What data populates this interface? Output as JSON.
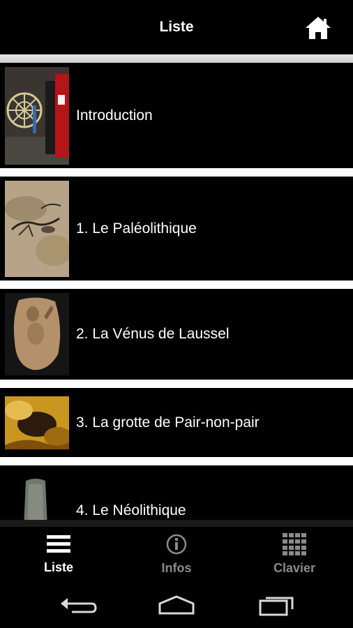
{
  "header": {
    "title": "Liste",
    "home_icon": "home-icon"
  },
  "list": {
    "items": [
      {
        "label": "Introduction",
        "thumb": "intro-image"
      },
      {
        "label": "1. Le Paléolithique",
        "thumb": "cave-painting-image"
      },
      {
        "label": "2. La Vénus de Laussel",
        "thumb": "venus-relief-image"
      },
      {
        "label": "3. La grotte de Pair-non-pair",
        "thumb": "cave-interior-image"
      },
      {
        "label": "4. Le Néolithique",
        "thumb": "stone-axe-image"
      }
    ]
  },
  "tabbar": {
    "tabs": [
      {
        "label": "Liste",
        "icon": "list-icon",
        "active": true
      },
      {
        "label": "Infos",
        "icon": "info-icon",
        "active": false
      },
      {
        "label": "Clavier",
        "icon": "keypad-icon",
        "active": false
      }
    ]
  },
  "system_nav": {
    "back": "back-icon",
    "home": "home-nav-icon",
    "recents": "recents-icon"
  },
  "colors": {
    "background": "#000000",
    "separator": "#ffffff",
    "inactive_tab": "#8a8a8a"
  }
}
